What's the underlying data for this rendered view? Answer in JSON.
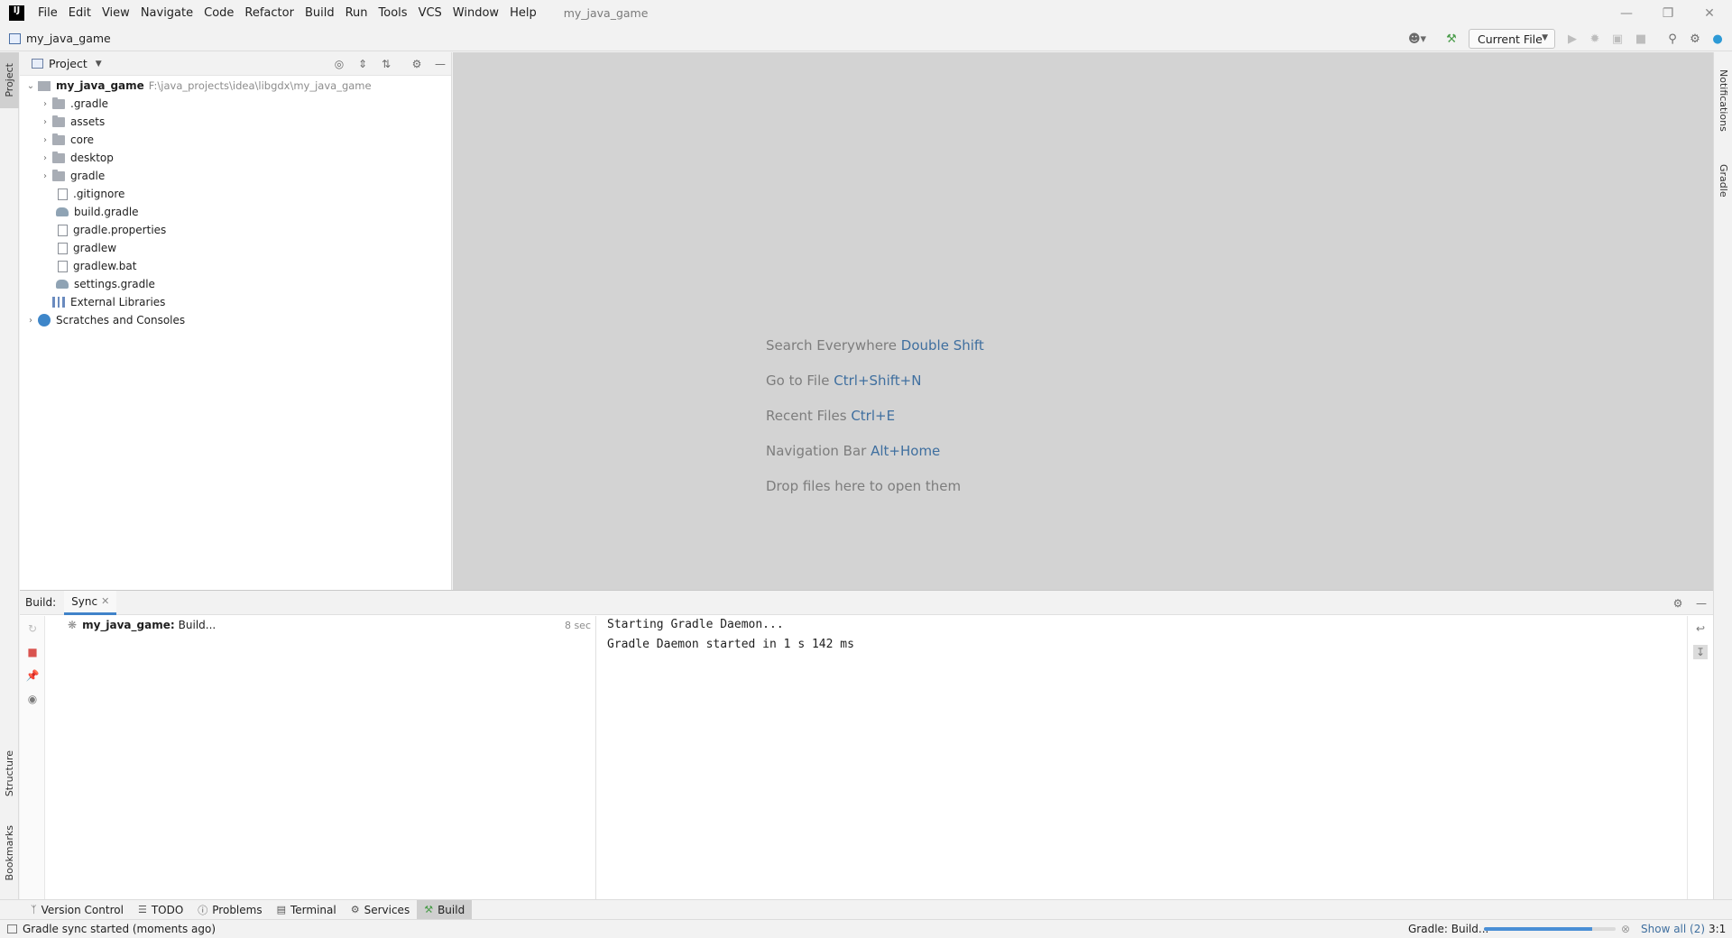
{
  "menubar": {
    "items": [
      "File",
      "Edit",
      "View",
      "Navigate",
      "Code",
      "Refactor",
      "Build",
      "Run",
      "Tools",
      "VCS",
      "Window",
      "Help"
    ],
    "window_title": "my_java_game"
  },
  "navbar": {
    "project_name": "my_java_game",
    "run_config": "Current File"
  },
  "left_stripe": {
    "project": "Project",
    "structure": "Structure",
    "bookmarks": "Bookmarks"
  },
  "right_stripe": {
    "notifications": "Notifications",
    "gradle": "Gradle"
  },
  "project_panel": {
    "title": "Project",
    "root": {
      "name": "my_java_game",
      "path": "F:\\java_projects\\idea\\libgdx\\my_java_game"
    },
    "folders": [
      ".gradle",
      "assets",
      "core",
      "desktop",
      "gradle"
    ],
    "files": [
      ".gitignore",
      "build.gradle",
      "gradle.properties",
      "gradlew",
      "gradlew.bat",
      "settings.gradle"
    ],
    "external_libraries": "External Libraries",
    "scratches": "Scratches and Consoles"
  },
  "editor_hints": [
    {
      "text": "Search Everywhere",
      "key": "Double Shift"
    },
    {
      "text": "Go to File",
      "key": "Ctrl+Shift+N"
    },
    {
      "text": "Recent Files",
      "key": "Ctrl+E"
    },
    {
      "text": "Navigation Bar",
      "key": "Alt+Home"
    },
    {
      "text": "Drop files here to open them",
      "key": ""
    }
  ],
  "build_window": {
    "label": "Build:",
    "tab": "Sync",
    "task_name": "my_java_game:",
    "task_status": "Build...",
    "task_time": "8 sec",
    "console_lines": [
      "Starting Gradle Daemon...",
      "Gradle Daemon started in 1 s 142 ms"
    ]
  },
  "bottom_tabs": [
    "Version Control",
    "TODO",
    "Problems",
    "Terminal",
    "Services",
    "Build"
  ],
  "statusbar": {
    "message": "Gradle sync started (moments ago)",
    "task": "Gradle: Build...",
    "show_all": "Show all (2)",
    "position": "3:1",
    "progress": 0.82
  }
}
